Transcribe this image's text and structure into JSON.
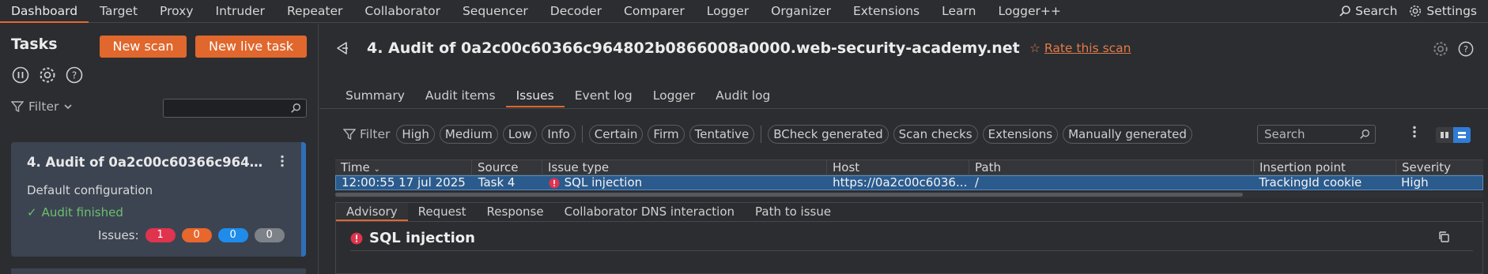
{
  "topbar": {
    "menu": [
      "Dashboard",
      "Target",
      "Proxy",
      "Intruder",
      "Repeater",
      "Collaborator",
      "Sequencer",
      "Decoder",
      "Comparer",
      "Logger",
      "Organizer",
      "Extensions",
      "Learn",
      "Logger++"
    ],
    "search_label": "Search",
    "settings_label": "Settings"
  },
  "left": {
    "title": "Tasks",
    "new_scan": "New scan",
    "new_live_task": "New live task",
    "filter_label": "Filter",
    "task": {
      "title": "4. Audit of 0a2c00c60366c96480...",
      "config": "Default configuration",
      "status": "Audit finished",
      "issues_label": "Issues:",
      "counts": [
        "1",
        "0",
        "0",
        "0"
      ]
    }
  },
  "main": {
    "title": "4. Audit of 0a2c00c60366c964802b0866008a0000.web-security-academy.net",
    "rate": "Rate this scan",
    "tabs": [
      "Summary",
      "Audit items",
      "Issues",
      "Event log",
      "Logger",
      "Audit log"
    ],
    "filter_label": "Filter",
    "chips_severity": [
      "High",
      "Medium",
      "Low",
      "Info"
    ],
    "chips_confidence": [
      "Certain",
      "Firm",
      "Tentative"
    ],
    "chips_source": [
      "BCheck generated",
      "Scan checks",
      "Extensions",
      "Manually generated"
    ],
    "search_placeholder": "Search",
    "columns": [
      "Time",
      "Source",
      "Issue type",
      "Host",
      "Path",
      "Insertion point",
      "Severity"
    ],
    "row": {
      "time": "12:00:55 17 jul 2025",
      "source": "Task 4",
      "issue_type": "SQL injection",
      "host": "https://0a2c00c6036...",
      "path": "/",
      "insertion_point": "TrackingId cookie",
      "severity": "High"
    },
    "subtabs": [
      "Advisory",
      "Request",
      "Response",
      "Collaborator DNS interaction",
      "Path to issue"
    ],
    "advisory_title": "SQL injection"
  },
  "colors": {
    "accent": "#e0672d",
    "high": "#e0334d",
    "medium": "#e8672d",
    "low": "#1f8ceb",
    "info": "#7d8288",
    "selected_row": "#2b5b8d",
    "ok": "#6cbf6c"
  }
}
